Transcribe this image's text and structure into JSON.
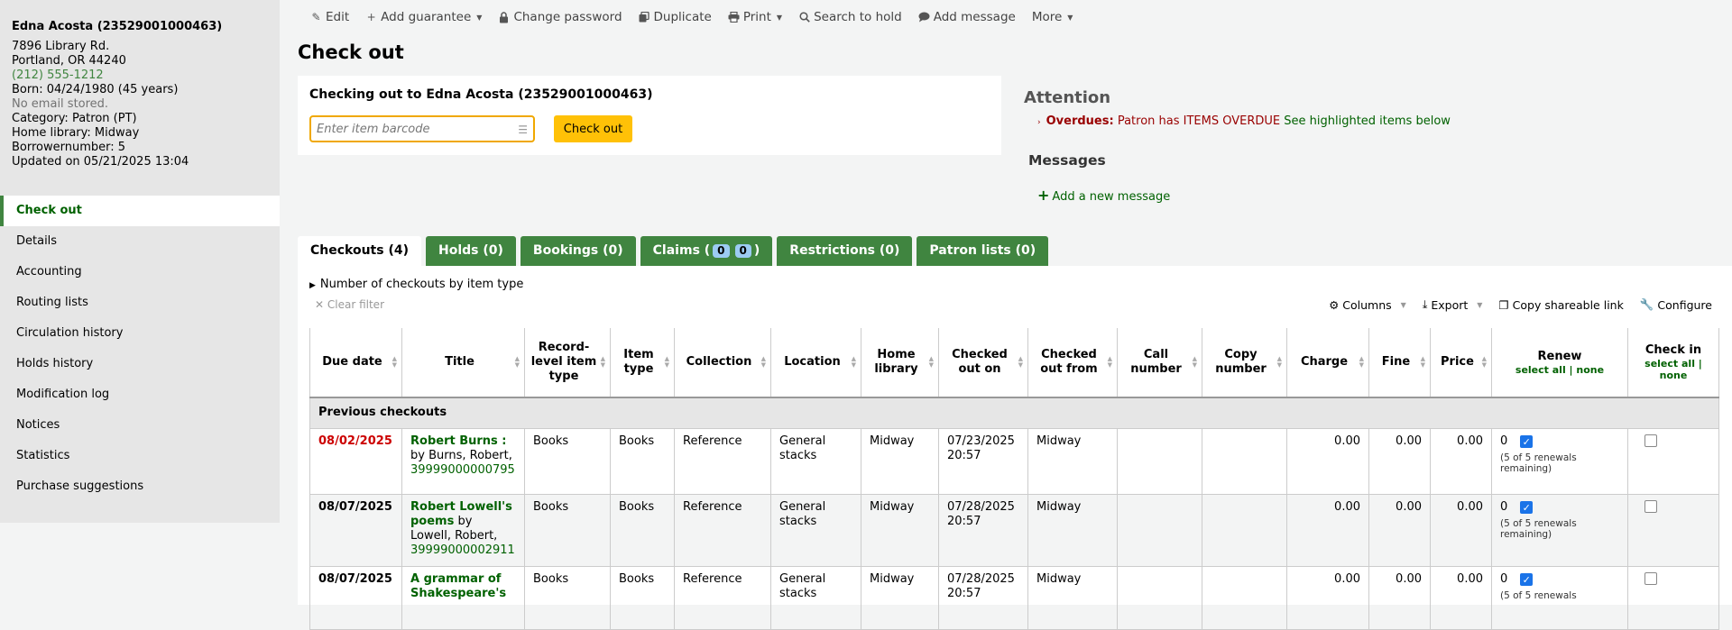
{
  "patron": {
    "name": "Edna Acosta (23529001000463)",
    "address1": "7896 Library Rd.",
    "address2": "Portland, OR 44240",
    "phone": "(212) 555-1212",
    "born": "Born: 04/24/1980 (45 years)",
    "email": "No email stored.",
    "category": "Category: Patron (PT)",
    "home_library": "Home library: Midway",
    "borrowernumber": "Borrowernumber: 5",
    "updated": "Updated on 05/21/2025 13:04"
  },
  "sidebar": {
    "items": [
      {
        "label": "Check out",
        "active": true
      },
      {
        "label": "Details"
      },
      {
        "label": "Accounting"
      },
      {
        "label": "Routing lists"
      },
      {
        "label": "Circulation history"
      },
      {
        "label": "Holds history"
      },
      {
        "label": "Modification log"
      },
      {
        "label": "Notices"
      },
      {
        "label": "Statistics"
      },
      {
        "label": "Purchase suggestions"
      }
    ]
  },
  "toolbar": {
    "edit": "Edit",
    "add_guarantee": "Add guarantee",
    "change_password": "Change password",
    "duplicate": "Duplicate",
    "print": "Print",
    "search_to_hold": "Search to hold",
    "add_message": "Add message",
    "more": "More"
  },
  "page_title": "Check out",
  "checkout_form": {
    "heading": "Checking out to Edna Acosta (23529001000463)",
    "placeholder": "Enter item barcode",
    "button": "Check out"
  },
  "attention": {
    "title": "Attention",
    "overdues_label": "Overdues:",
    "overdues_text": "Patron has ITEMS OVERDUE",
    "overdues_link": "See highlighted items below"
  },
  "messages": {
    "title": "Messages",
    "add_link": "Add a new message"
  },
  "tabs": {
    "checkouts": "Checkouts (4)",
    "holds": "Holds (0)",
    "bookings": "Bookings (0)",
    "claims_prefix": "Claims (",
    "claims_count1": "0",
    "claims_count2": "0",
    "claims_suffix": ")",
    "restrictions": "Restrictions (0)",
    "patron_lists": "Patron lists (0)"
  },
  "panel": {
    "summary_toggle": "Number of checkouts by item type",
    "clear_filter": "Clear filter",
    "columns": "Columns",
    "export": "Export",
    "copy_link": "Copy shareable link",
    "configure": "Configure"
  },
  "table": {
    "headers": {
      "due_date": "Due date",
      "title": "Title",
      "record_level_item_type": "Record-level item type",
      "item_type": "Item type",
      "collection": "Collection",
      "location": "Location",
      "home_library": "Home library",
      "checked_out_on": "Checked out on",
      "checked_out_from": "Checked out from",
      "call_number": "Call number",
      "copy_number": "Copy number",
      "charge": "Charge",
      "fine": "Fine",
      "price": "Price",
      "renew": "Renew",
      "renew_select": "select all | none",
      "check_in": "Check in",
      "checkin_select": "select all | none"
    },
    "group_label": "Previous checkouts",
    "rows": [
      {
        "due": "08/02/2025",
        "title": "Robert Burns :",
        "author": "by Burns, Robert,",
        "barcode": "39999000000795",
        "record_type": "Books",
        "item_type": "Books",
        "collection": "Reference",
        "location": "General stacks",
        "home_library": "Midway",
        "checked_out_on": "07/23/2025 20:57",
        "checked_out_from": "Midway",
        "call_number": "",
        "copy_number": "",
        "charge": "0.00",
        "fine": "0.00",
        "price": "0.00",
        "renew_count": "0",
        "renew_note": "(5 of 5 renewals remaining)"
      },
      {
        "due": "08/07/2025",
        "title": "Robert Lowell's poems",
        "author": "by Lowell, Robert,",
        "barcode": "39999000002911",
        "record_type": "Books",
        "item_type": "Books",
        "collection": "Reference",
        "location": "General stacks",
        "home_library": "Midway",
        "checked_out_on": "07/28/2025 20:57",
        "checked_out_from": "Midway",
        "call_number": "",
        "copy_number": "",
        "charge": "0.00",
        "fine": "0.00",
        "price": "0.00",
        "renew_count": "0",
        "renew_note": "(5 of 5 renewals remaining)"
      },
      {
        "due": "08/07/2025",
        "title": "A grammar of Shakespeare's",
        "author": "",
        "barcode": "",
        "record_type": "Books",
        "item_type": "Books",
        "collection": "Reference",
        "location": "General stacks",
        "home_library": "Midway",
        "checked_out_on": "07/28/2025 20:57",
        "checked_out_from": "Midway",
        "call_number": "",
        "copy_number": "",
        "charge": "0.00",
        "fine": "0.00",
        "price": "0.00",
        "renew_count": "0",
        "renew_note": "(5 of 5 renewals"
      }
    ]
  },
  "colors": {
    "accent_green": "#408540",
    "link_green": "#006100",
    "overdue_red": "#cc0000",
    "button_yellow": "#ffc107"
  }
}
